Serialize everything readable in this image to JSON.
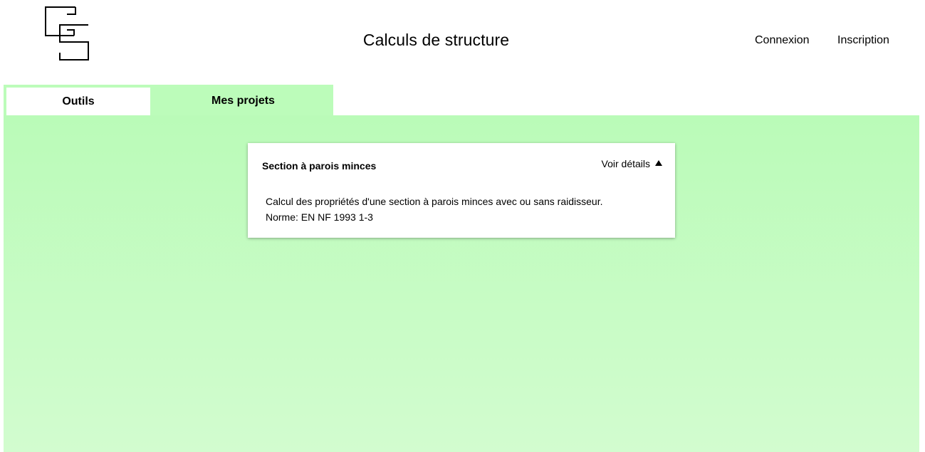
{
  "header": {
    "title": "Calculs de structure",
    "nav": {
      "login": "Connexion",
      "signup": "Inscription"
    }
  },
  "tabs": [
    {
      "label": "Outils",
      "active": false
    },
    {
      "label": "Mes projets",
      "active": true
    }
  ],
  "colors": {
    "accent_green": "#bcfcba",
    "panel_bottom": "#d2fccf"
  },
  "card": {
    "title": "Section à parois minces",
    "toggle_label": "Voir détails",
    "toggle_icon": "triangle-up-icon",
    "description": "Calcul des propriétés d'une section à parois minces avec ou sans raidisseur.",
    "norm": "Norme: EN NF 1993 1-3"
  }
}
